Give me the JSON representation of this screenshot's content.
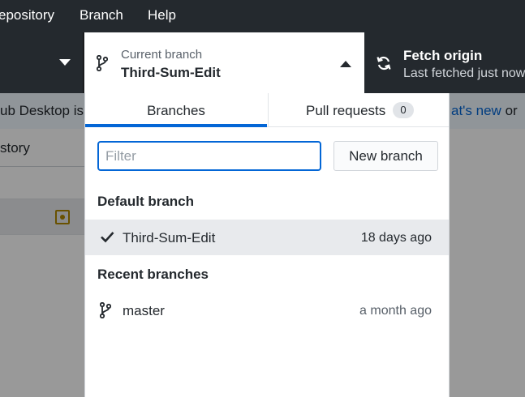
{
  "menu": {
    "items": [
      "epository",
      "Branch",
      "Help"
    ]
  },
  "toolbar": {
    "current_branch_label": "Current branch",
    "current_branch_value": "Third-Sum-Edit",
    "fetch_title": "Fetch origin",
    "fetch_subtitle": "Last fetched just now"
  },
  "background": {
    "notice_left": "ub Desktop is",
    "notice_link": "at's new",
    "notice_after": " or",
    "history_tab": "story"
  },
  "dropdown": {
    "tabs": {
      "branches": "Branches",
      "pull_requests": "Pull requests",
      "pull_requests_count": "0"
    },
    "filter_placeholder": "Filter",
    "new_branch_label": "New branch",
    "default_section": "Default branch",
    "default_branches": [
      {
        "name": "Third-Sum-Edit",
        "date": "18 days ago",
        "selected": true,
        "icon": "check-icon"
      }
    ],
    "recent_section": "Recent branches",
    "recent_branches": [
      {
        "name": "master",
        "date": "a month ago",
        "selected": false,
        "icon": "git-branch-icon"
      }
    ]
  },
  "colors": {
    "chrome": "#24292e",
    "accent": "#0366d6",
    "selected_row": "#e8eaed",
    "modified": "#b08800"
  }
}
